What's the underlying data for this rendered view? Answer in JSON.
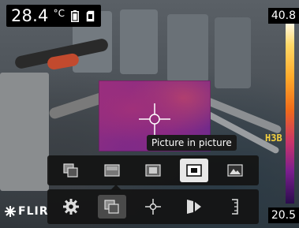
{
  "temperature": {
    "value": "28.4",
    "unit": "°C"
  },
  "status_icons": [
    "battery-icon",
    "sd-card-icon"
  ],
  "scale": {
    "max": "40.8",
    "min": "20.5"
  },
  "tooltip": "Picture in picture",
  "label_h3b": "H3B",
  "logo_text": "FLIR",
  "image_modes": [
    {
      "icon": "msx-mode-icon",
      "selected": false
    },
    {
      "icon": "thermal-mode-icon",
      "selected": false
    },
    {
      "icon": "thermal-center-mode-icon",
      "selected": false
    },
    {
      "icon": "picture-in-picture-icon",
      "selected": true
    },
    {
      "icon": "digital-camera-mode-icon",
      "selected": false
    }
  ],
  "toolbar": [
    {
      "icon": "settings-gear-icon",
      "selected": false
    },
    {
      "icon": "image-mode-icon",
      "selected": true
    },
    {
      "icon": "measurement-spot-icon",
      "selected": false
    },
    {
      "icon": "color-palette-icon",
      "selected": false
    },
    {
      "icon": "scale-adjust-icon",
      "selected": false
    }
  ]
}
